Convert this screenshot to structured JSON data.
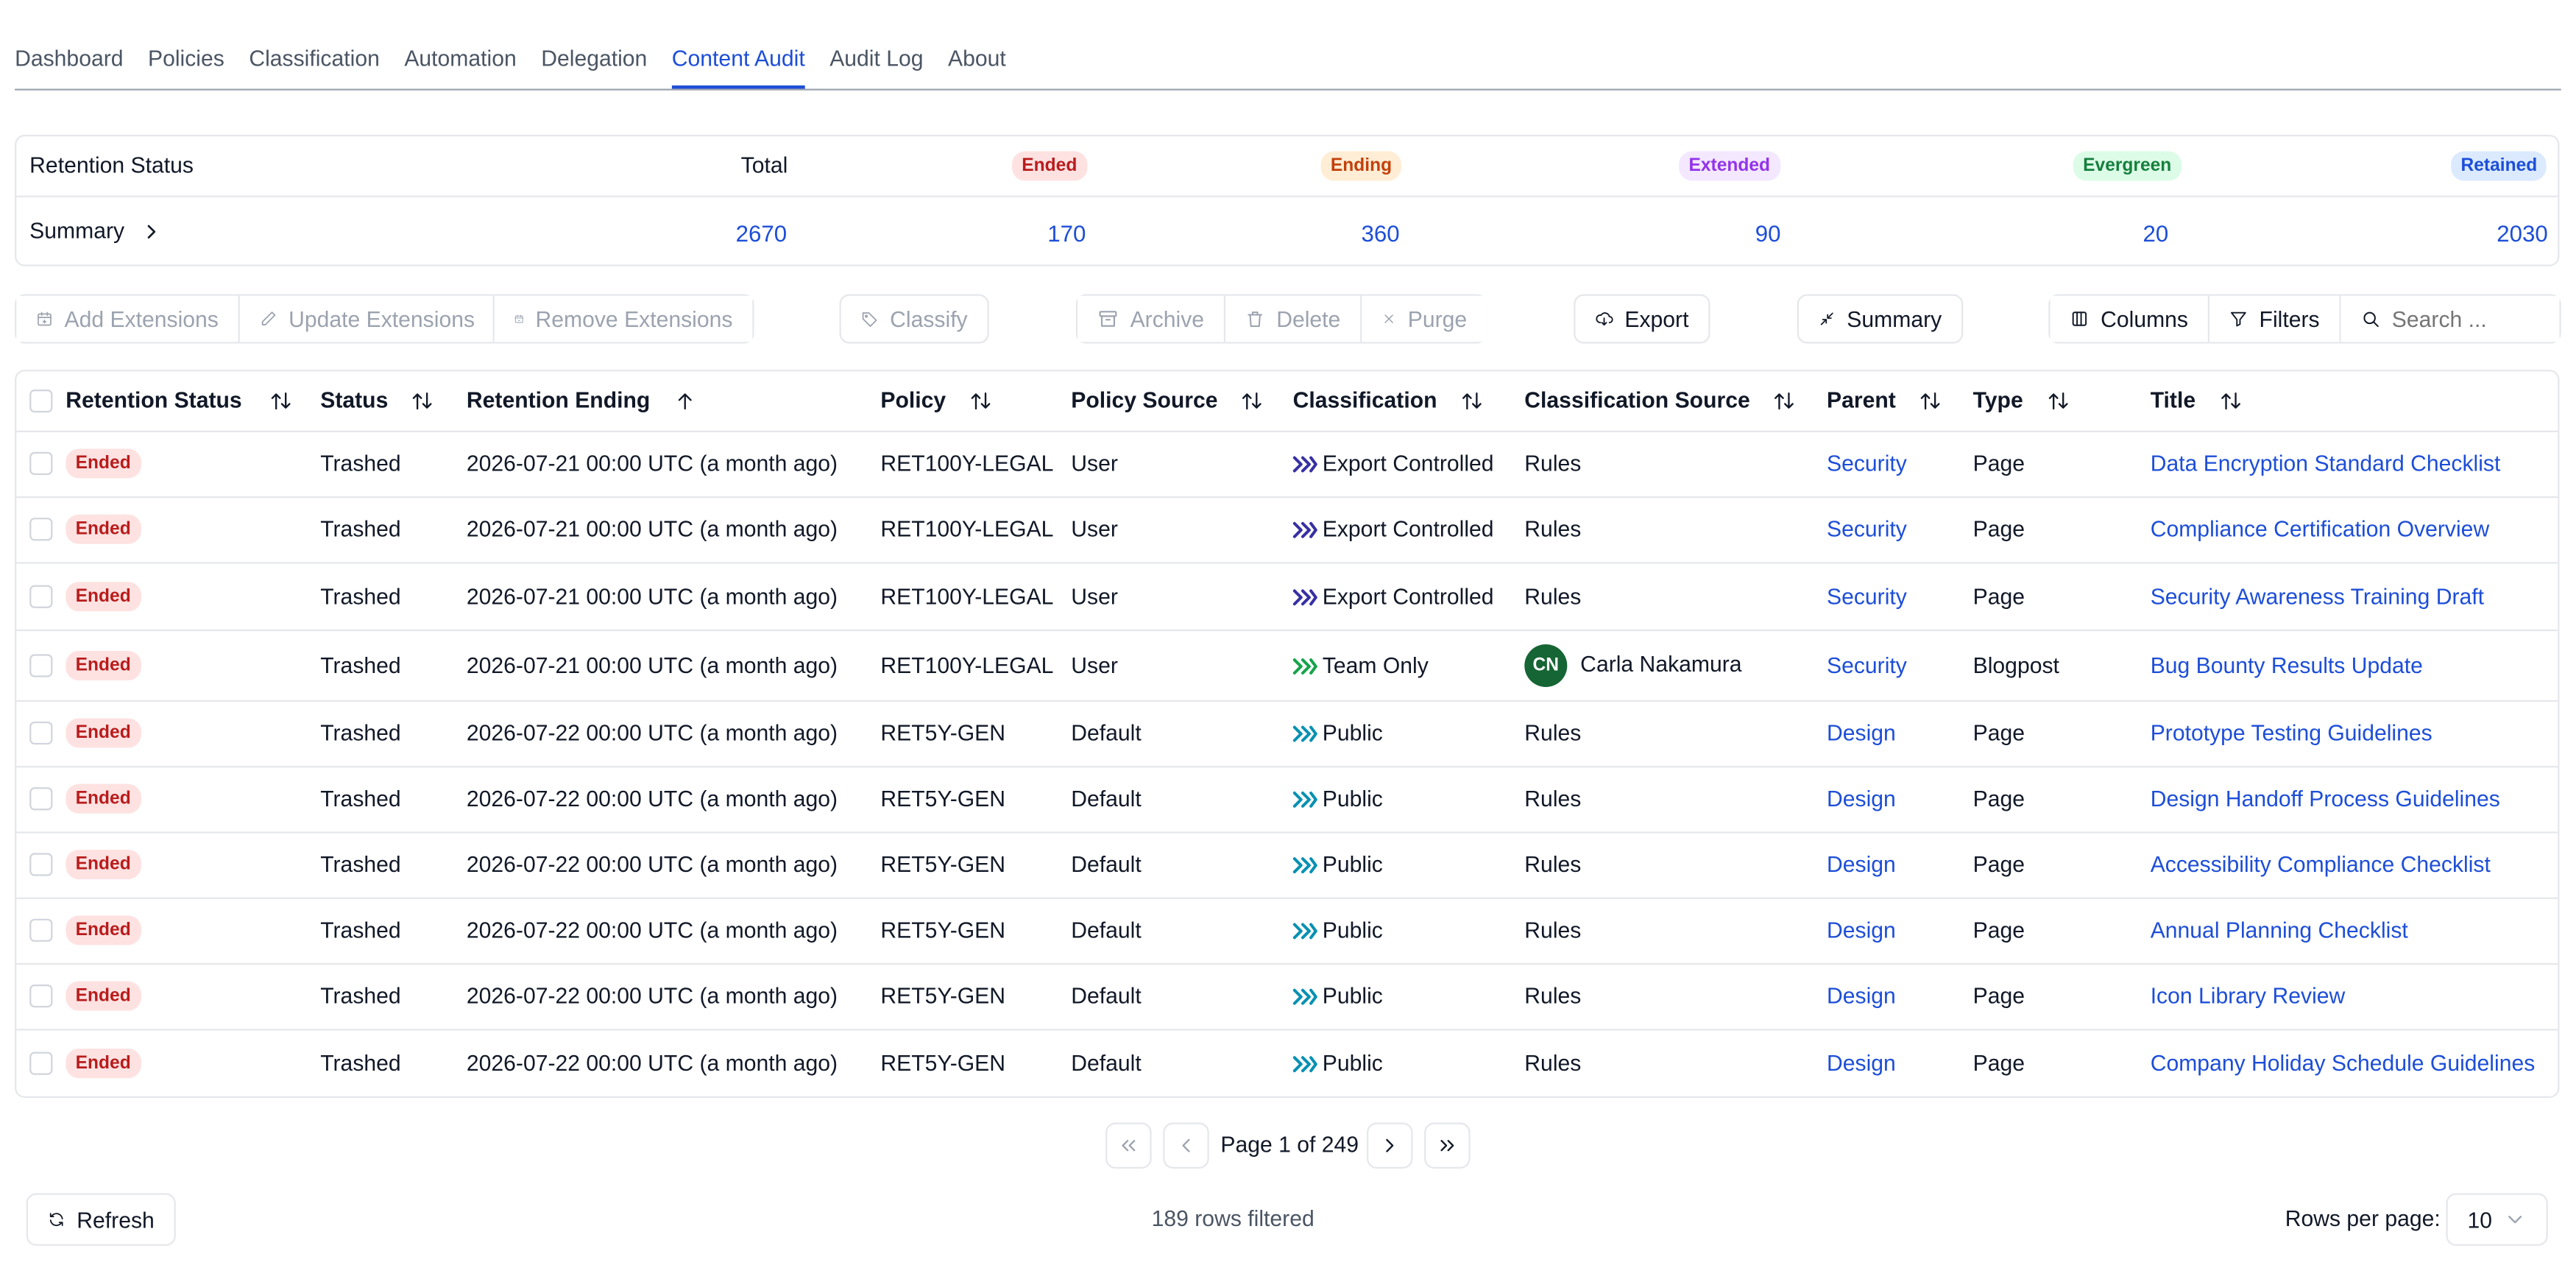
{
  "tabs": [
    {
      "label": "Dashboard"
    },
    {
      "label": "Policies"
    },
    {
      "label": "Classification"
    },
    {
      "label": "Automation"
    },
    {
      "label": "Delegation"
    },
    {
      "label": "Content Audit",
      "active": true
    },
    {
      "label": "Audit Log"
    },
    {
      "label": "About"
    }
  ],
  "summary": {
    "title": "Retention Status",
    "row_label": "Summary",
    "total_label": "Total",
    "total_value": "2670",
    "statuses": [
      {
        "label": "Ended",
        "value": "170",
        "color": "#b91c1c",
        "bg": "#fee2e2"
      },
      {
        "label": "Ending",
        "value": "360",
        "color": "#c2410c",
        "bg": "#ffedd5"
      },
      {
        "label": "Extended",
        "value": "90",
        "color": "#9333ea",
        "bg": "#f3e8ff"
      },
      {
        "label": "Evergreen",
        "value": "20",
        "color": "#15803d",
        "bg": "#dcfce7"
      },
      {
        "label": "Retained",
        "value": "2030",
        "color": "#1d4ed8",
        "bg": "#dbeafe"
      }
    ]
  },
  "toolbar": {
    "add_extensions": "Add Extensions",
    "update_extensions": "Update Extensions",
    "remove_extensions": "Remove Extensions",
    "classify": "Classify",
    "archive": "Archive",
    "delete": "Delete",
    "purge": "Purge",
    "export": "Export",
    "summary": "Summary",
    "columns": "Columns",
    "filters": "Filters",
    "search_placeholder": "Search ..."
  },
  "table": {
    "headers": {
      "retention_status": "Retention Status",
      "status": "Status",
      "retention_ending": "Retention Ending",
      "policy": "Policy",
      "policy_source": "Policy Source",
      "classification": "Classification",
      "classification_source": "Classification Source",
      "parent": "Parent",
      "type": "Type",
      "title": "Title"
    },
    "rows": [
      {
        "retention_status": "Ended",
        "status": "Trashed",
        "retention_ending": "2026-07-21 00:00 UTC (a month ago)",
        "policy": "RET100Y-LEGAL",
        "policy_source": "User",
        "classification": "Export Controlled",
        "classification_color": "#3730a3",
        "classification_source": "Rules",
        "parent": "Security",
        "type": "Page",
        "title": "Data Encryption Standard Checklist"
      },
      {
        "retention_status": "Ended",
        "status": "Trashed",
        "retention_ending": "2026-07-21 00:00 UTC (a month ago)",
        "policy": "RET100Y-LEGAL",
        "policy_source": "User",
        "classification": "Export Controlled",
        "classification_color": "#3730a3",
        "classification_source": "Rules",
        "parent": "Security",
        "type": "Page",
        "title": "Compliance Certification Overview"
      },
      {
        "retention_status": "Ended",
        "status": "Trashed",
        "retention_ending": "2026-07-21 00:00 UTC (a month ago)",
        "policy": "RET100Y-LEGAL",
        "policy_source": "User",
        "classification": "Export Controlled",
        "classification_color": "#3730a3",
        "classification_source": "Rules",
        "parent": "Security",
        "type": "Page",
        "title": "Security Awareness Training Draft"
      },
      {
        "retention_status": "Ended",
        "status": "Trashed",
        "retention_ending": "2026-07-21 00:00 UTC (a month ago)",
        "policy": "RET100Y-LEGAL",
        "policy_source": "User",
        "classification": "Team Only",
        "classification_color": "#16a34a",
        "classification_source": "Carla Nakamura",
        "avatar": "CN",
        "parent": "Security",
        "type": "Blogpost",
        "title": "Bug Bounty Results Update"
      },
      {
        "retention_status": "Ended",
        "status": "Trashed",
        "retention_ending": "2026-07-22 00:00 UTC (a month ago)",
        "policy": "RET5Y-GEN",
        "policy_source": "Default",
        "classification": "Public",
        "classification_color": "#0891b2",
        "classification_source": "Rules",
        "parent": "Design",
        "type": "Page",
        "title": "Prototype Testing Guidelines"
      },
      {
        "retention_status": "Ended",
        "status": "Trashed",
        "retention_ending": "2026-07-22 00:00 UTC (a month ago)",
        "policy": "RET5Y-GEN",
        "policy_source": "Default",
        "classification": "Public",
        "classification_color": "#0891b2",
        "classification_source": "Rules",
        "parent": "Design",
        "type": "Page",
        "title": "Design Handoff Process Guidelines"
      },
      {
        "retention_status": "Ended",
        "status": "Trashed",
        "retention_ending": "2026-07-22 00:00 UTC (a month ago)",
        "policy": "RET5Y-GEN",
        "policy_source": "Default",
        "classification": "Public",
        "classification_color": "#0891b2",
        "classification_source": "Rules",
        "parent": "Design",
        "type": "Page",
        "title": "Accessibility Compliance Checklist"
      },
      {
        "retention_status": "Ended",
        "status": "Trashed",
        "retention_ending": "2026-07-22 00:00 UTC (a month ago)",
        "policy": "RET5Y-GEN",
        "policy_source": "Default",
        "classification": "Public",
        "classification_color": "#0891b2",
        "classification_source": "Rules",
        "parent": "Design",
        "type": "Page",
        "title": "Annual Planning Checklist"
      },
      {
        "retention_status": "Ended",
        "status": "Trashed",
        "retention_ending": "2026-07-22 00:00 UTC (a month ago)",
        "policy": "RET5Y-GEN",
        "policy_source": "Default",
        "classification": "Public",
        "classification_color": "#0891b2",
        "classification_source": "Rules",
        "parent": "Design",
        "type": "Page",
        "title": "Icon Library Review"
      },
      {
        "retention_status": "Ended",
        "status": "Trashed",
        "retention_ending": "2026-07-22 00:00 UTC (a month ago)",
        "policy": "RET5Y-GEN",
        "policy_source": "Default",
        "classification": "Public",
        "classification_color": "#0891b2",
        "classification_source": "Rules",
        "parent": "Design",
        "type": "Page",
        "title": "Company Holiday Schedule Guidelines"
      }
    ]
  },
  "pagination": {
    "page_text": "Page 1 of 249"
  },
  "footer": {
    "refresh": "Refresh",
    "rows_filtered": "189 rows filtered",
    "rows_per_page_label": "Rows per page:",
    "rows_per_page_value": "10"
  }
}
